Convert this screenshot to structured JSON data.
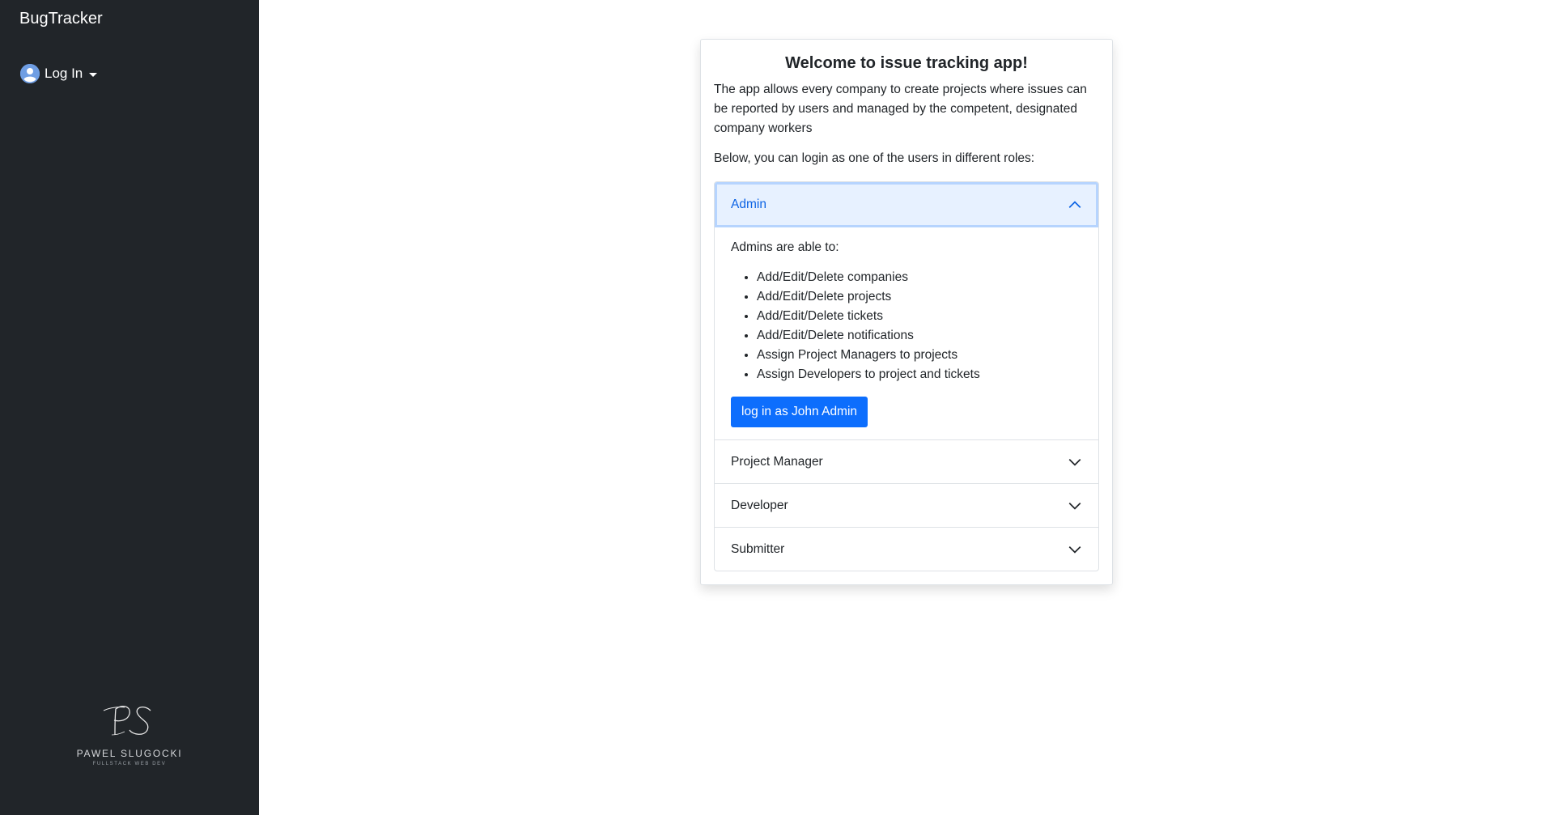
{
  "sidebar": {
    "brand": "BugTracker",
    "login_label": "Log In",
    "signature": {
      "monogram": "PS",
      "name": "PAWEL SLUGOCKI",
      "subtitle": "FULLSTACK WEB DEV"
    }
  },
  "card": {
    "title": "Welcome to issue tracking app!",
    "intro": "The app allows every company to create projects where issues can be reported by users and managed by the competent, designated company workers",
    "below": "Below, you can login as one of the users in different roles:"
  },
  "accordion": {
    "admin": {
      "label": "Admin",
      "expanded": true,
      "intro": "Admins are able to:",
      "abilities": [
        "Add/Edit/Delete companies",
        "Add/Edit/Delete projects",
        "Add/Edit/Delete tickets",
        "Add/Edit/Delete notifications",
        "Assign Project Managers to projects",
        "Assign Developers to project and tickets"
      ],
      "button_label": "log in as John Admin"
    },
    "project_manager": {
      "label": "Project Manager",
      "expanded": false
    },
    "developer": {
      "label": "Developer",
      "expanded": false
    },
    "submitter": {
      "label": "Submitter",
      "expanded": false
    }
  },
  "colors": {
    "sidebar_bg": "#212529",
    "accent": "#0d6efd",
    "active_header_bg": "#e7f1ff",
    "active_header_text": "#0c63e4"
  },
  "icons": {
    "user": "user-circle-icon",
    "caret": "caret-down-icon",
    "expanded": "chevron-up-icon",
    "collapsed": "chevron-down-icon"
  }
}
